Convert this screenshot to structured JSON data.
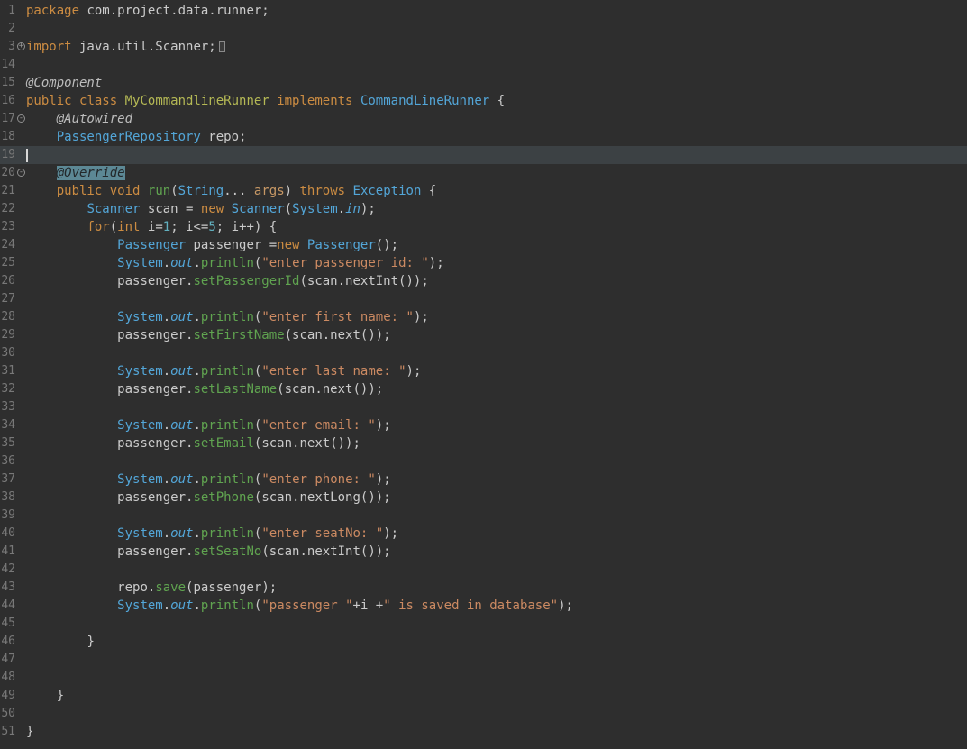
{
  "editor": {
    "kind": "dark-theme Java source editor",
    "first_line_number": "1",
    "last_line_number": "51",
    "folded_line_range_hidden": "4-13",
    "current_line_number": "19"
  },
  "colors": {
    "bg": "#2e2e2e",
    "gutter": "#787878",
    "text": "#cbcbcb",
    "curline": "#3c4144",
    "kw": "#cc8c42",
    "st": "#cc8a62",
    "ty": "#53a6d8",
    "de": "#b5b955",
    "me": "#60a450",
    "an": "#bdbdbd",
    "ahbg": "#5c8895",
    "ahfg": "#23282b",
    "nu": "#62b0bf",
    "cursor": "#d8d8d8"
  },
  "token_styles": {
    "kw": "keyword",
    "pl": "plain-text",
    "ty": "type-name",
    "de": "class-declaration-name",
    "me": "method-name",
    "st": "string-literal",
    "an": "annotation",
    "ah": "annotation-highlighted-occurrence",
    "nu": "number-literal",
    "fi": "static-field-italic",
    "pa": "parameter",
    "un": "underlined-variable",
    "bx": "folded-region-box"
  },
  "lines": [
    {
      "n": "1",
      "tokens": [
        [
          "kw",
          "package"
        ],
        [
          "pl",
          " com.project.data.runner;"
        ]
      ]
    },
    {
      "n": "2",
      "tokens": []
    },
    {
      "n": "3",
      "fold": "plus",
      "tokens": [
        [
          "kw",
          "import"
        ],
        [
          "pl",
          " java.util.Scanner;"
        ],
        [
          "bx",
          ""
        ]
      ]
    },
    {
      "n": "14",
      "tokens": []
    },
    {
      "n": "15",
      "tokens": [
        [
          "an",
          "@Component"
        ]
      ]
    },
    {
      "n": "16",
      "tokens": [
        [
          "kw",
          "public"
        ],
        [
          "pl",
          " "
        ],
        [
          "kw",
          "class"
        ],
        [
          "pl",
          " "
        ],
        [
          "de",
          "MyCommandlineRunner"
        ],
        [
          "pl",
          " "
        ],
        [
          "kw",
          "implements"
        ],
        [
          "pl",
          " "
        ],
        [
          "ty",
          "CommandLineRunner"
        ],
        [
          "pl",
          " {"
        ]
      ]
    },
    {
      "n": "17",
      "fold": "minus",
      "ind": 1,
      "tokens": [
        [
          "an",
          "@Autowired"
        ]
      ]
    },
    {
      "n": "18",
      "ind": 1,
      "tokens": [
        [
          "ty",
          "PassengerRepository"
        ],
        [
          "pl",
          " repo;"
        ]
      ]
    },
    {
      "n": "19",
      "current": true,
      "cursor": true,
      "tokens": []
    },
    {
      "n": "20",
      "fold": "minus",
      "ind": 1,
      "tokens": [
        [
          "ah",
          "@Override"
        ]
      ]
    },
    {
      "n": "21",
      "ind": 1,
      "tokens": [
        [
          "kw",
          "public"
        ],
        [
          "pl",
          " "
        ],
        [
          "kw",
          "void"
        ],
        [
          "pl",
          " "
        ],
        [
          "me",
          "run"
        ],
        [
          "pl",
          "("
        ],
        [
          "ty",
          "String"
        ],
        [
          "pl",
          "... "
        ],
        [
          "pa",
          "args"
        ],
        [
          "pl",
          ") "
        ],
        [
          "kw",
          "throws"
        ],
        [
          "pl",
          " "
        ],
        [
          "ty",
          "Exception"
        ],
        [
          "pl",
          " {"
        ]
      ]
    },
    {
      "n": "22",
      "ind": 2,
      "tokens": [
        [
          "ty",
          "Scanner"
        ],
        [
          "pl",
          " "
        ],
        [
          "un",
          "scan"
        ],
        [
          "pl",
          " = "
        ],
        [
          "kw",
          "new"
        ],
        [
          "pl",
          " "
        ],
        [
          "ty",
          "Scanner"
        ],
        [
          "pl",
          "("
        ],
        [
          "ty",
          "System"
        ],
        [
          "pl",
          "."
        ],
        [
          "fi",
          "in"
        ],
        [
          "pl",
          ");"
        ]
      ]
    },
    {
      "n": "23",
      "ind": 2,
      "tokens": [
        [
          "kw",
          "for"
        ],
        [
          "pl",
          "("
        ],
        [
          "kw",
          "int"
        ],
        [
          "pl",
          " i="
        ],
        [
          "nu",
          "1"
        ],
        [
          "pl",
          "; i<="
        ],
        [
          "nu",
          "5"
        ],
        [
          "pl",
          "; i++) {"
        ]
      ]
    },
    {
      "n": "24",
      "ind": 3,
      "tokens": [
        [
          "ty",
          "Passenger"
        ],
        [
          "pl",
          " passenger ="
        ],
        [
          "kw",
          "new"
        ],
        [
          "pl",
          " "
        ],
        [
          "ty",
          "Passenger"
        ],
        [
          "pl",
          "();"
        ]
      ]
    },
    {
      "n": "25",
      "ind": 3,
      "tokens": [
        [
          "ty",
          "System"
        ],
        [
          "pl",
          "."
        ],
        [
          "fi",
          "out"
        ],
        [
          "pl",
          "."
        ],
        [
          "me",
          "println"
        ],
        [
          "pl",
          "("
        ],
        [
          "st",
          "\"enter passenger id: \""
        ],
        [
          "pl",
          ");"
        ]
      ]
    },
    {
      "n": "26",
      "ind": 3,
      "tokens": [
        [
          "pl",
          "passenger."
        ],
        [
          "me",
          "setPassengerId"
        ],
        [
          "pl",
          "(scan.nextInt());"
        ]
      ]
    },
    {
      "n": "27",
      "tokens": []
    },
    {
      "n": "28",
      "ind": 3,
      "tokens": [
        [
          "ty",
          "System"
        ],
        [
          "pl",
          "."
        ],
        [
          "fi",
          "out"
        ],
        [
          "pl",
          "."
        ],
        [
          "me",
          "println"
        ],
        [
          "pl",
          "("
        ],
        [
          "st",
          "\"enter first name: \""
        ],
        [
          "pl",
          ");"
        ]
      ]
    },
    {
      "n": "29",
      "ind": 3,
      "tokens": [
        [
          "pl",
          "passenger."
        ],
        [
          "me",
          "setFirstName"
        ],
        [
          "pl",
          "(scan.next());"
        ]
      ]
    },
    {
      "n": "30",
      "tokens": []
    },
    {
      "n": "31",
      "ind": 3,
      "tokens": [
        [
          "ty",
          "System"
        ],
        [
          "pl",
          "."
        ],
        [
          "fi",
          "out"
        ],
        [
          "pl",
          "."
        ],
        [
          "me",
          "println"
        ],
        [
          "pl",
          "("
        ],
        [
          "st",
          "\"enter last name: \""
        ],
        [
          "pl",
          ");"
        ]
      ]
    },
    {
      "n": "32",
      "ind": 3,
      "tokens": [
        [
          "pl",
          "passenger."
        ],
        [
          "me",
          "setLastName"
        ],
        [
          "pl",
          "(scan.next());"
        ]
      ]
    },
    {
      "n": "33",
      "tokens": []
    },
    {
      "n": "34",
      "ind": 3,
      "tokens": [
        [
          "ty",
          "System"
        ],
        [
          "pl",
          "."
        ],
        [
          "fi",
          "out"
        ],
        [
          "pl",
          "."
        ],
        [
          "me",
          "println"
        ],
        [
          "pl",
          "("
        ],
        [
          "st",
          "\"enter email: \""
        ],
        [
          "pl",
          ");"
        ]
      ]
    },
    {
      "n": "35",
      "ind": 3,
      "tokens": [
        [
          "pl",
          "passenger."
        ],
        [
          "me",
          "setEmail"
        ],
        [
          "pl",
          "(scan.next());"
        ]
      ]
    },
    {
      "n": "36",
      "tokens": []
    },
    {
      "n": "37",
      "ind": 3,
      "tokens": [
        [
          "ty",
          "System"
        ],
        [
          "pl",
          "."
        ],
        [
          "fi",
          "out"
        ],
        [
          "pl",
          "."
        ],
        [
          "me",
          "println"
        ],
        [
          "pl",
          "("
        ],
        [
          "st",
          "\"enter phone: \""
        ],
        [
          "pl",
          ");"
        ]
      ]
    },
    {
      "n": "38",
      "ind": 3,
      "tokens": [
        [
          "pl",
          "passenger."
        ],
        [
          "me",
          "setPhone"
        ],
        [
          "pl",
          "(scan.nextLong());"
        ]
      ]
    },
    {
      "n": "39",
      "tokens": []
    },
    {
      "n": "40",
      "ind": 3,
      "tokens": [
        [
          "ty",
          "System"
        ],
        [
          "pl",
          "."
        ],
        [
          "fi",
          "out"
        ],
        [
          "pl",
          "."
        ],
        [
          "me",
          "println"
        ],
        [
          "pl",
          "("
        ],
        [
          "st",
          "\"enter seatNo: \""
        ],
        [
          "pl",
          ");"
        ]
      ]
    },
    {
      "n": "41",
      "ind": 3,
      "tokens": [
        [
          "pl",
          "passenger."
        ],
        [
          "me",
          "setSeatNo"
        ],
        [
          "pl",
          "(scan.nextInt());"
        ]
      ]
    },
    {
      "n": "42",
      "tokens": []
    },
    {
      "n": "43",
      "ind": 3,
      "tokens": [
        [
          "pl",
          "repo."
        ],
        [
          "me",
          "save"
        ],
        [
          "pl",
          "(passenger);"
        ]
      ]
    },
    {
      "n": "44",
      "ind": 3,
      "tokens": [
        [
          "ty",
          "System"
        ],
        [
          "pl",
          "."
        ],
        [
          "fi",
          "out"
        ],
        [
          "pl",
          "."
        ],
        [
          "me",
          "println"
        ],
        [
          "pl",
          "("
        ],
        [
          "st",
          "\"passenger \""
        ],
        [
          "pl",
          "+i +"
        ],
        [
          "st",
          "\" is saved in database\""
        ],
        [
          "pl",
          ");"
        ]
      ]
    },
    {
      "n": "45",
      "tokens": []
    },
    {
      "n": "46",
      "ind": 2,
      "tokens": [
        [
          "pl",
          "}"
        ]
      ]
    },
    {
      "n": "47",
      "tokens": []
    },
    {
      "n": "48",
      "tokens": []
    },
    {
      "n": "49",
      "ind": 1,
      "tokens": [
        [
          "pl",
          "}"
        ]
      ]
    },
    {
      "n": "50",
      "tokens": []
    },
    {
      "n": "51",
      "tokens": [
        [
          "pl",
          "}"
        ]
      ]
    }
  ]
}
